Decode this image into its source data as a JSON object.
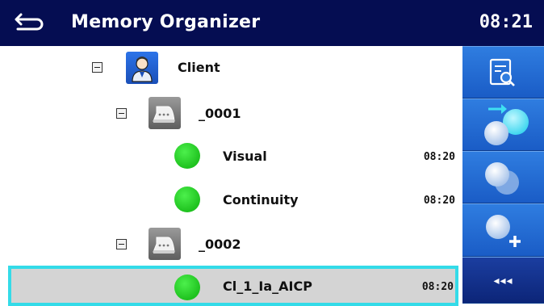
{
  "header": {
    "title": "Memory Organizer",
    "time": "08:21",
    "back_icon": "back-arrow-icon"
  },
  "tree": {
    "client": {
      "label": "Client",
      "icon": "client-person-icon"
    },
    "device_1": {
      "label": "_0001",
      "icon": "device-iron-icon"
    },
    "test_visual": {
      "label": "Visual",
      "time": "08:20",
      "status": "pass"
    },
    "test_continuity": {
      "label": "Continuity",
      "time": "08:20",
      "status": "pass"
    },
    "device_2": {
      "label": "_0002",
      "icon": "device-iron-icon"
    },
    "test_cl": {
      "label": "Cl_1_Ia_AICP",
      "time": "08:20",
      "status": "pass"
    }
  },
  "sidebar": {
    "buttons": [
      {
        "icon": "view-details-icon"
      },
      {
        "icon": "start-test-icon"
      },
      {
        "icon": "clone-icon"
      },
      {
        "icon": "add-node-icon"
      }
    ],
    "more_label": "◂◂◂"
  },
  "colors": {
    "header_bg": "#050d52",
    "selection_border": "#34dbe8",
    "selection_bg": "#d4d4d4",
    "pass_green": "#22c722",
    "sidebar_blue": "#2f7de0"
  }
}
